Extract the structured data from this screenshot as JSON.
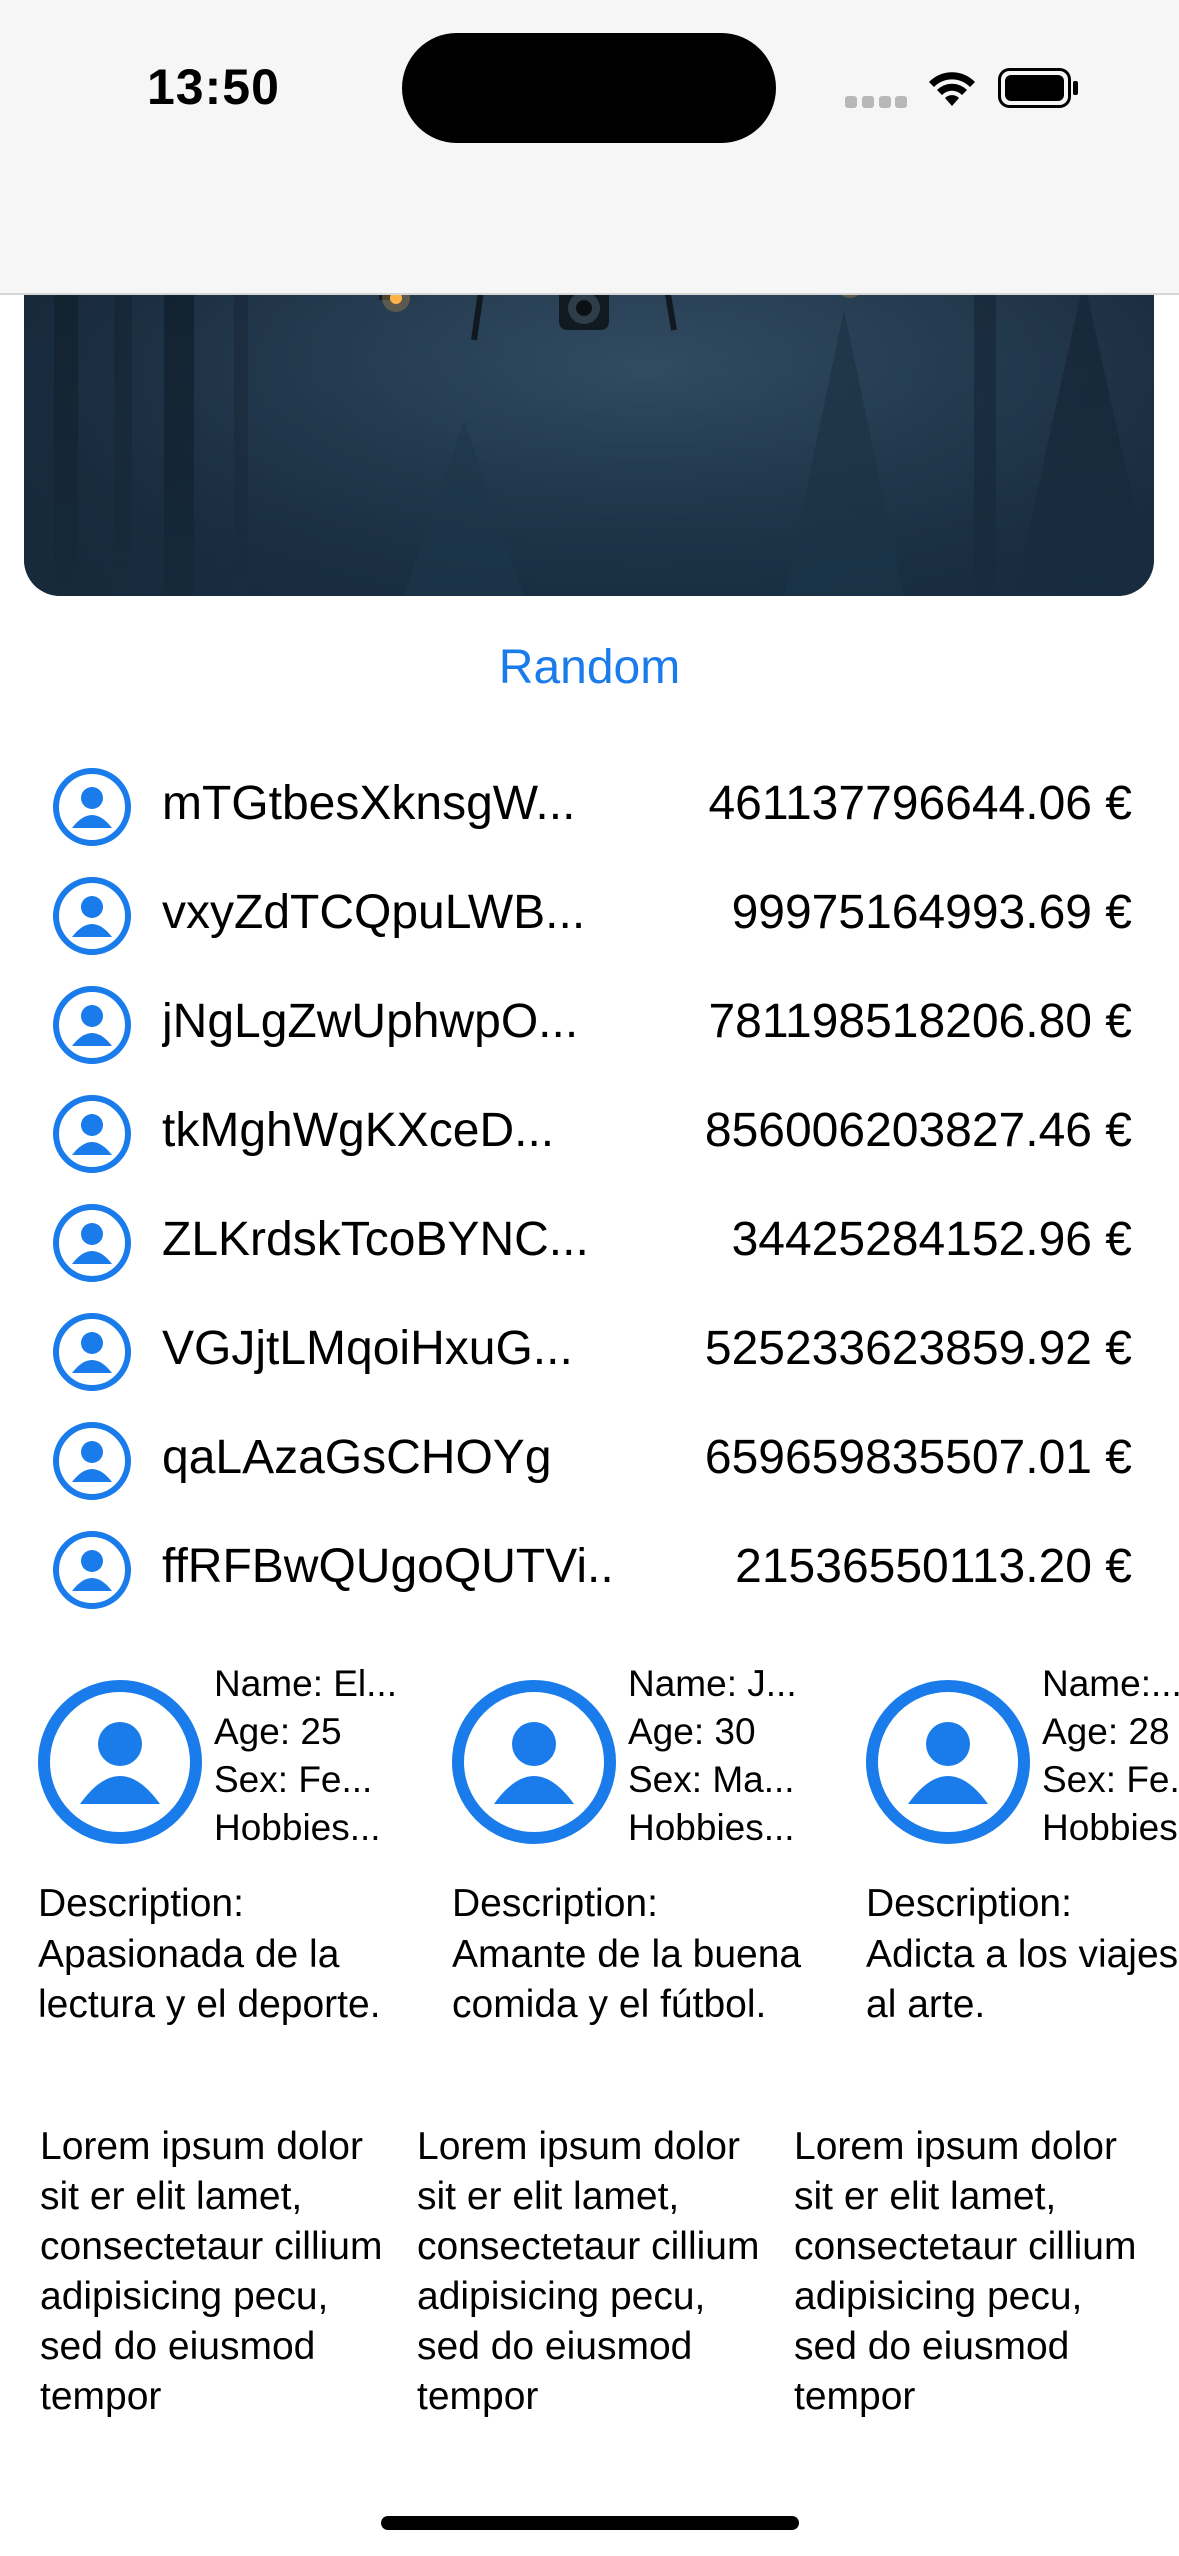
{
  "status_bar": {
    "time": "13:50",
    "icons": [
      "signal-dots-icon",
      "wifi-icon",
      "battery-icon"
    ]
  },
  "hero": {
    "image": "drone-in-forest-photo"
  },
  "random_label": "Random",
  "accent_color": "#1a7bea",
  "users": [
    {
      "name": "mTGtbesXknsgW...",
      "amount": "461137796644.06 €"
    },
    {
      "name": "vxyZdTCQpuLWB...",
      "amount": "99975164993.69 €"
    },
    {
      "name": "jNgLgZwUphwpO...",
      "amount": "781198518206.80 €"
    },
    {
      "name": "tkMghWgKXceD...",
      "amount": "856006203827.46 €"
    },
    {
      "name": "ZLKrdskTcoBYNC...",
      "amount": "34425284152.96 €"
    },
    {
      "name": "VGJjtLMqoiHxuG...",
      "amount": "525233623859.92 €"
    },
    {
      "name": "qaLAzaGsCHOYg",
      "amount": "659659835507.01 €"
    },
    {
      "name": "ffRFBwQUgoQUTVi...",
      "amount": "21536550113.20 €"
    }
  ],
  "profiles": [
    {
      "name": "Name: El...",
      "age": "Age: 25",
      "sex": "Sex: Fe...",
      "hobbies": "Hobbies...",
      "description_label": "Description:",
      "description": "Apasionada de la lectura y el deporte."
    },
    {
      "name": "Name: J...",
      "age": "Age: 30",
      "sex": "Sex: Ma...",
      "hobbies": "Hobbies...",
      "description_label": "Description:",
      "description": "Amante de la buena comida y el fútbol."
    },
    {
      "name": "Name:...",
      "age": "Age: 28",
      "sex": "Sex: Fe...",
      "hobbies": "Hobbies...",
      "description_label": "Description:",
      "description": "Adicta a los viajes y al arte."
    }
  ],
  "lorems": [
    "Lorem ipsum dolor sit er elit lamet, consectetaur cillium adipisicing pecu, sed do eiusmod tempor",
    "Lorem ipsum dolor sit er elit lamet, consectetaur cillium adipisicing pecu, sed do eiusmod tempor",
    "Lorem ipsum dolor sit er elit lamet, consectetaur cillium adipisicing pecu, sed do eiusmod tempor"
  ]
}
